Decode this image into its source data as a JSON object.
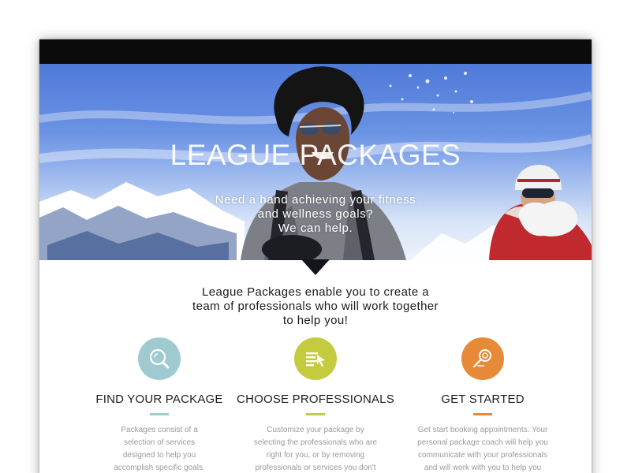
{
  "hero": {
    "title": "LEAGUE PACKAGES",
    "subtitle_lines": [
      "Need a hand achieving your fitness",
      "and wellness goals?",
      "We can help."
    ]
  },
  "intro": {
    "lines": [
      "League Packages enable you to create a",
      "team of professionals who will work together",
      "to help you!"
    ]
  },
  "features": [
    {
      "icon": "magnifier-icon",
      "color": "#9fcbd0",
      "title": "FIND YOUR PACKAGE",
      "description_lines": [
        "Packages consist of a",
        "selection of services",
        "designed to help you",
        "accomplish specific goals."
      ]
    },
    {
      "icon": "list-cursor-icon",
      "color": "#c4cb3f",
      "title": "CHOOSE PROFESSIONALS",
      "description_lines": [
        "Customize your package by",
        "selecting the professionals who are",
        "right for you, or by removing",
        "professionals or services you don't"
      ]
    },
    {
      "icon": "pin-icon",
      "color": "#e78a37",
      "title": "GET STARTED",
      "description_lines": [
        "Get start booking appointments. Your",
        "personal package coach will help you",
        "communicate with your professionals",
        "and will work with you to help you"
      ]
    }
  ]
}
